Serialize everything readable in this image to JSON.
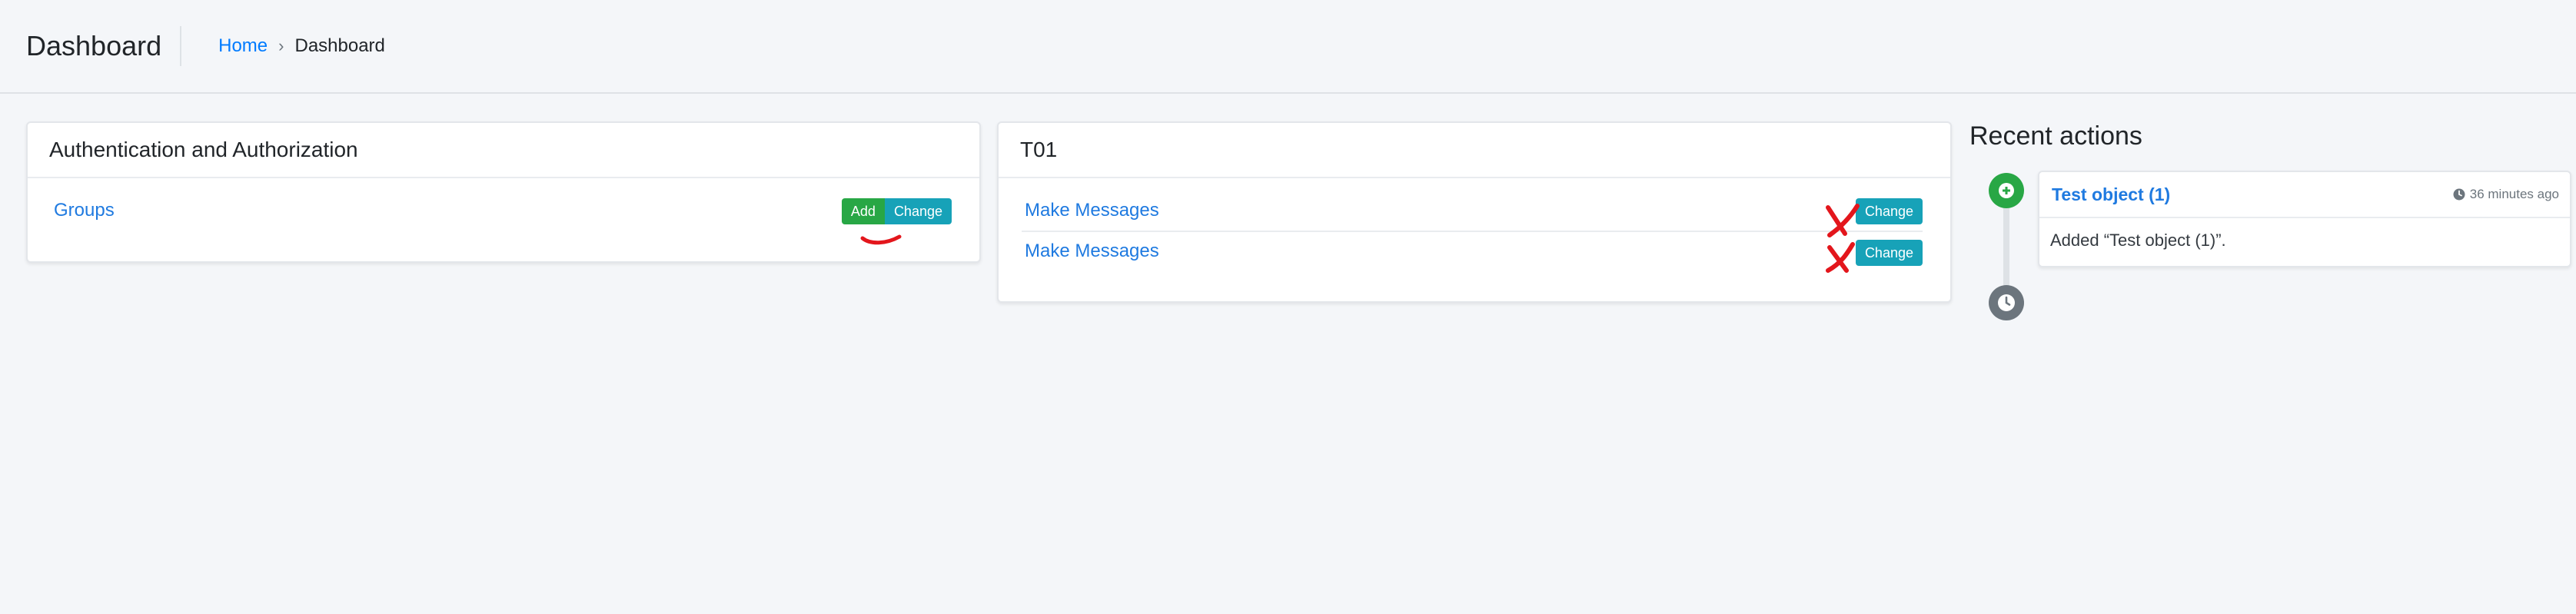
{
  "header": {
    "title": "Dashboard",
    "breadcrumb": {
      "home": "Home",
      "separator": "›",
      "current": "Dashboard"
    }
  },
  "apps": [
    {
      "name": "Authentication and Authorization",
      "models": [
        {
          "label": "Groups",
          "add_label": "Add",
          "change_label": "Change"
        }
      ]
    },
    {
      "name": "T01",
      "models": [
        {
          "label": "Make Messages",
          "change_label": "Change"
        },
        {
          "label": "Make Messages",
          "change_label": "Change"
        }
      ]
    }
  ],
  "recent_actions": {
    "title": "Recent actions",
    "items": [
      {
        "object": "Test object (1)",
        "time": "36 minutes ago",
        "message": "Added “Test object (1)”."
      }
    ]
  },
  "icons": {
    "add": "plus-circle-icon",
    "clock": "clock-icon",
    "annotation_check": "red-checkmark",
    "annotation_cross": "red-x-mark"
  },
  "colors": {
    "link": "#1f7ae0",
    "add": "#28a745",
    "change": "#17a2b8",
    "annotation": "#e3161c"
  }
}
